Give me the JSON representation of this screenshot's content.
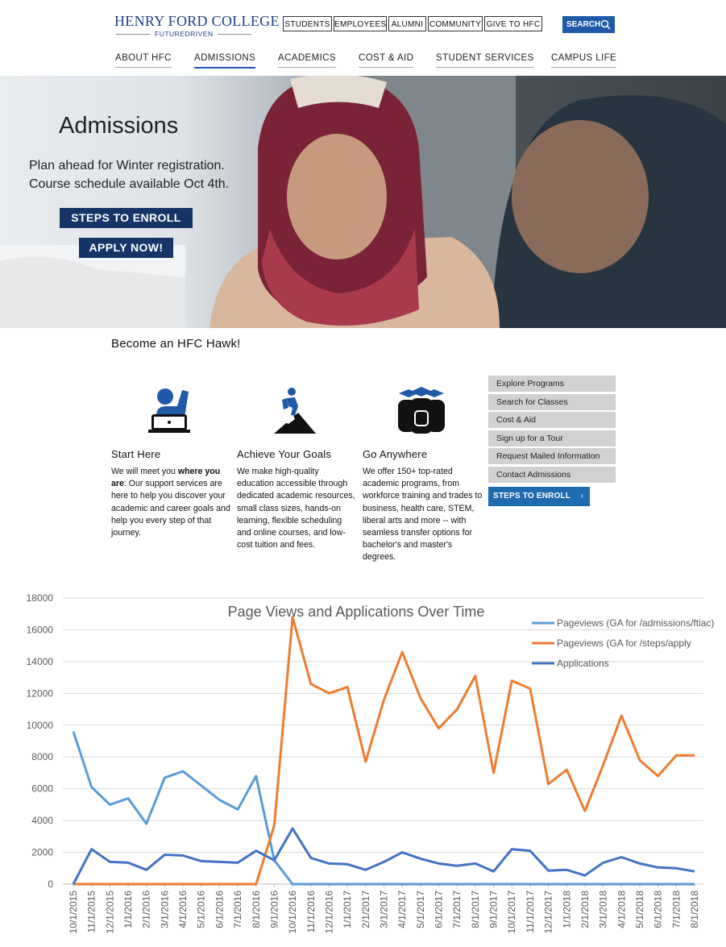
{
  "header": {
    "logo_name": "HENRY FORD COLLEGE",
    "logo_tagline": "FUTUREDRIVEN",
    "utility_links": [
      "STUDENTS",
      "EMPLOYEES",
      "ALUMNI",
      "COMMUNITY",
      "GIVE TO HFC"
    ],
    "search_label": "SEARCH",
    "main_nav": [
      "ABOUT HFC",
      "ADMISSIONS",
      "ACADEMICS",
      "COST & AID",
      "STUDENT SERVICES",
      "CAMPUS LIFE"
    ],
    "active_nav": "ADMISSIONS"
  },
  "hero": {
    "title": "Admissions",
    "subtitle_line1": "Plan ahead for Winter registration.",
    "subtitle_line2": "Course schedule available Oct 4th.",
    "btn_enroll": "STEPS TO ENROLL",
    "btn_apply": "APPLY NOW!"
  },
  "section": {
    "title": "Become an HFC Hawk!",
    "columns": [
      {
        "icon": "raised-hand-laptop-icon",
        "heading": "Start Here",
        "body_pre": "We will meet you ",
        "body_bold": "where you are",
        "body_post": ": Our support services are here to help you discover your academic and career goals and help you every step of that journey."
      },
      {
        "icon": "hiker-climbing-icon",
        "heading": "Achieve Your Goals",
        "body": "We make high-quality education accessible through dedicated academic resources, small class sizes, hands-on learning, flexible scheduling and online courses, and low-cost tuition and fees."
      },
      {
        "icon": "graduates-icon",
        "heading": "Go Anywhere",
        "body": "We offer 150+ top-rated academic programs, from workforce training and trades to business, health care, STEM, liberal arts and more -- with seamless transfer options for bachelor's and master's degrees."
      }
    ]
  },
  "quick_links": [
    "Explore Programs",
    "Search for Classes",
    "Cost & Aid",
    "Sign up for a Tour",
    "Request Mailed Information",
    "Contact Admissions"
  ],
  "enroll_small": "STEPS TO ENROLL",
  "colors": {
    "navy": "#143566",
    "brand_blue": "#1f5aa8",
    "light_blue_series": "#5b9bd5",
    "orange_series": "#ed7d31",
    "dark_blue_series": "#4472c4"
  },
  "chart_data": {
    "type": "line",
    "title": "Page Views and Applications Over Time",
    "ylim": [
      0,
      18000
    ],
    "yticks": [
      0,
      2000,
      4000,
      6000,
      8000,
      10000,
      12000,
      14000,
      16000,
      18000
    ],
    "categories": [
      "10/1/2015",
      "11/1/2015",
      "12/1/2015",
      "1/1/2016",
      "2/1/2016",
      "3/1/2016",
      "4/1/2016",
      "5/1/2016",
      "6/1/2016",
      "7/1/2016",
      "8/1/2016",
      "9/1/2016",
      "10/1/2016",
      "11/1/2016",
      "12/1/2016",
      "1/1/2017",
      "2/1/2017",
      "3/1/2017",
      "4/1/2017",
      "5/1/2017",
      "6/1/2017",
      "7/1/2017",
      "8/1/2017",
      "9/1/2017",
      "10/1/2017",
      "11/1/2017",
      "12/1/2017",
      "1/1/2018",
      "2/1/2018",
      "3/1/2018",
      "4/1/2018",
      "5/1/2018",
      "6/1/2018",
      "7/1/2018",
      "8/1/2018"
    ],
    "tick_labels": [
      "10/1/2015",
      "11/1/2015",
      "12/1/2015",
      "1/1/2016",
      "2/1/2016",
      "3/1/2016",
      "4/1/2016",
      "5/1/2016",
      "6/1/2016",
      "7/1/2016",
      "8/1/2016",
      "9/1/2016",
      "10/1/2016",
      "11/1/2016",
      "12/1/2016",
      "1/1/2017",
      "2/1/2017",
      "3/1/2017",
      "4/1/2017",
      "5/1/2017",
      "6/1/2017",
      "7/1/2017",
      "8/1/2017",
      "9/1/2017",
      "10/1/2017",
      "11/1/2017",
      "12/1/2017",
      "1/1/2018",
      "2/1/2018",
      "3/1/2018",
      "4/1/2018",
      "5/1/2018",
      "6/1/2018",
      "7/1/2018",
      "8/1/2018"
    ],
    "legend_position": "top-right",
    "grid": true,
    "series": [
      {
        "name": "Pageviews (GA for /admissions/ftiac)",
        "color": "#5b9bd5",
        "values": [
          9600,
          6100,
          5000,
          5400,
          3800,
          6700,
          7100,
          6200,
          5300,
          4700,
          6800,
          1500,
          0,
          0,
          0,
          0,
          0,
          0,
          0,
          0,
          0,
          0,
          0,
          0,
          0,
          0,
          0,
          0,
          0,
          0,
          0,
          0,
          0,
          0,
          0
        ]
      },
      {
        "name": "Pageviews (GA for /steps/apply",
        "color": "#ed7d31",
        "values": [
          0,
          0,
          0,
          0,
          0,
          0,
          0,
          0,
          0,
          0,
          0,
          3700,
          16800,
          12600,
          12000,
          12400,
          7700,
          11600,
          14600,
          11700,
          9800,
          11000,
          13100,
          7000,
          12800,
          12300,
          6300,
          7200,
          4600,
          7500,
          10600,
          7800,
          6800,
          8100,
          8100
        ]
      },
      {
        "name": "Applications",
        "color": "#4472c4",
        "values": [
          0,
          2200,
          1400,
          1350,
          900,
          1850,
          1800,
          1450,
          1400,
          1350,
          2100,
          1500,
          3500,
          1650,
          1300,
          1250,
          900,
          1400,
          2000,
          1600,
          1300,
          1150,
          1300,
          800,
          2200,
          2100,
          850,
          900,
          550,
          1350,
          1700,
          1300,
          1050,
          1000,
          800
        ]
      }
    ]
  }
}
